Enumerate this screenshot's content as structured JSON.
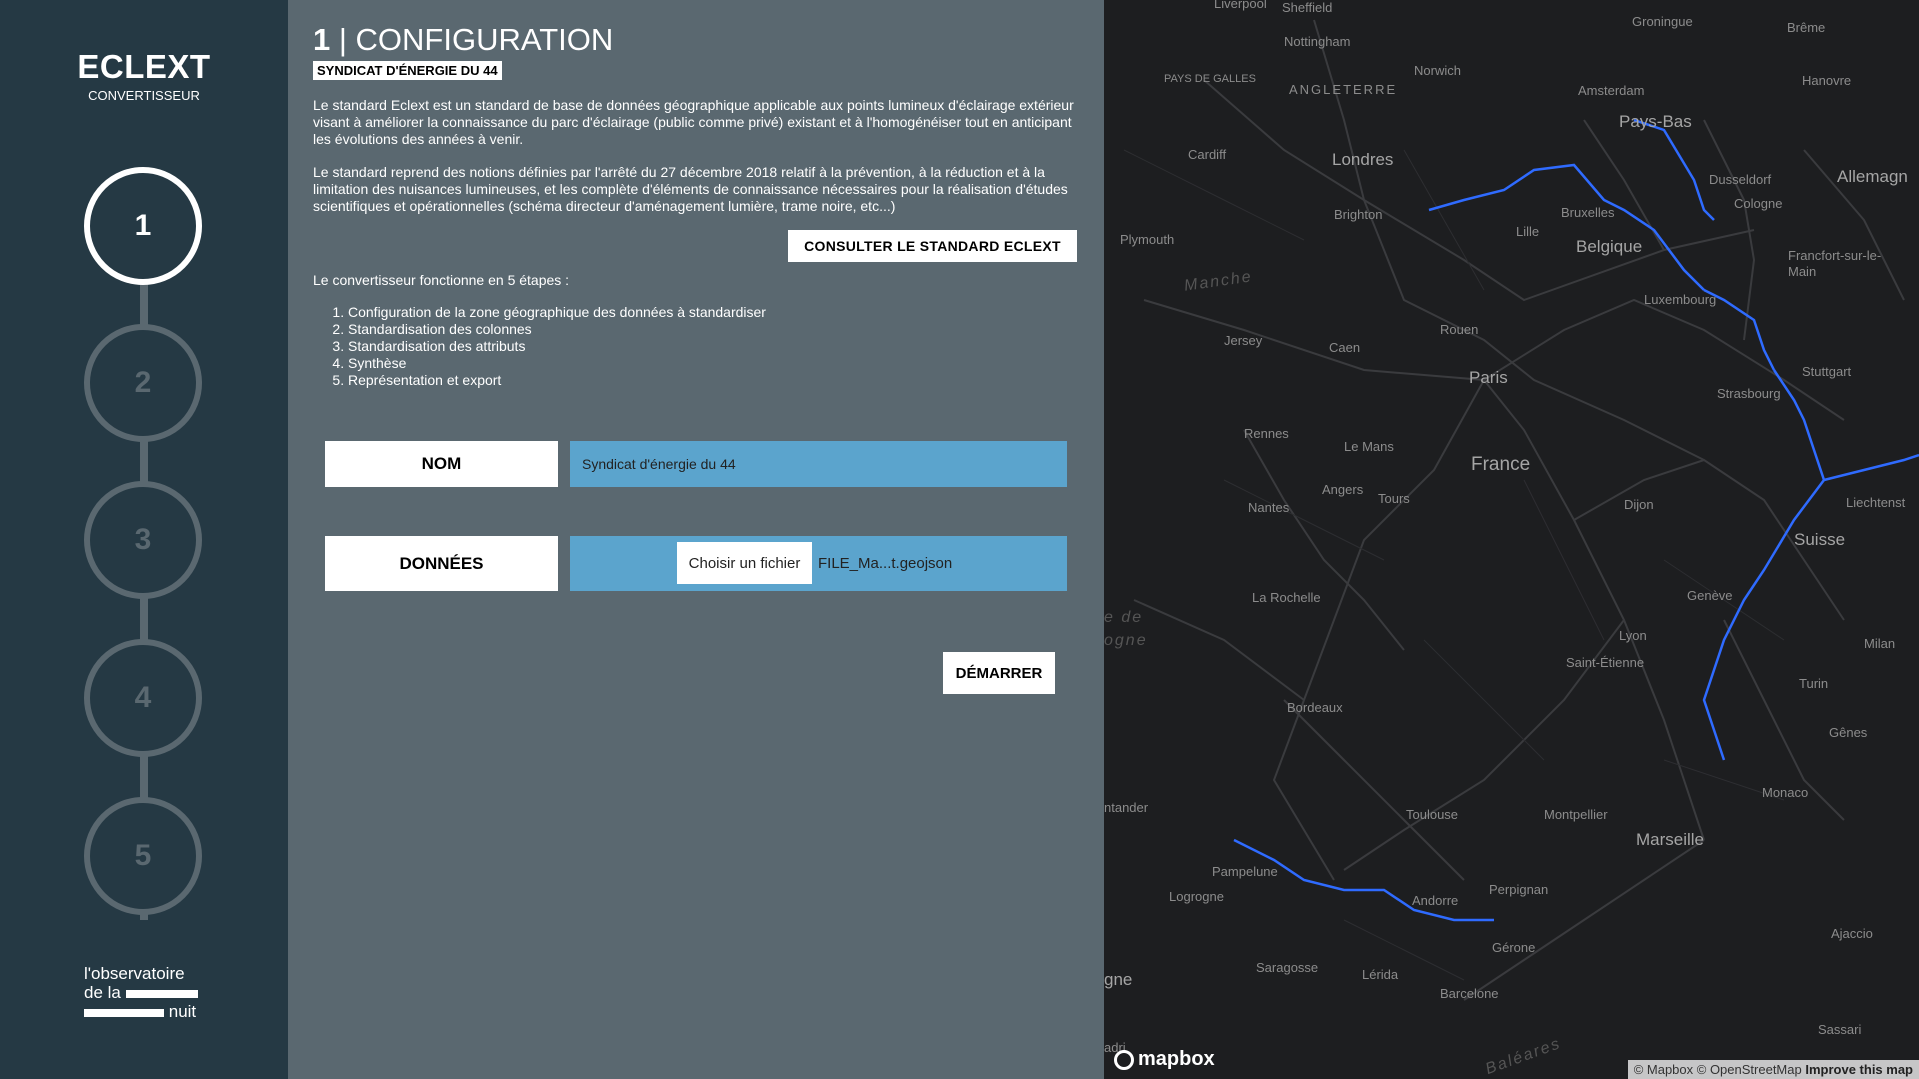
{
  "sidebar": {
    "title": "ECLEXT",
    "subtitle": "CONVERTISSEUR",
    "steps": [
      "1",
      "2",
      "3",
      "4",
      "5"
    ],
    "active_step": 1,
    "logo_lines": [
      "l'observatoire",
      "de la",
      "nuit"
    ]
  },
  "panel": {
    "title_number": "1",
    "title_text": "| CONFIGURATION",
    "tag": "SYNDICAT D'ÉNERGIE DU 44",
    "paragraph1": "Le standard Eclext est un standard de base de données géographique applicable aux points lumineux d'éclairage extérieur visant à améliorer la connaissance du parc d'éclairage (public comme privé) existant et à l'homogénéiser tout en anticipant les évolutions des années à venir.",
    "paragraph2": "Le standard reprend des notions définies par l'arrêté du 27 décembre 2018 relatif à la prévention, à la réduction et à la limitation des nuisances lumineuses, et les complète d'éléments de connaissance nécessaires pour la réalisation d'études scientifiques et opérationnelles (schéma directeur d'aménagement lumière, trame noire, etc...)",
    "consult_button": "CONSULTER LE STANDARD ECLEXT",
    "steps_intro": "Le convertisseur fonctionne en 5 étapes :",
    "steps": [
      "Configuration de la zone géographique des données à standardiser",
      "Standardisation des colonnes",
      "Standardisation des attributs",
      "Synthèse",
      "Représentation et export"
    ],
    "nom_label": "NOM",
    "nom_value": "Syndicat d'énergie du 44",
    "donnees_label": "DONNÉES",
    "file_button": "Choisir un fichier",
    "file_name": "FILE_Ma...t.geojson",
    "start_button": "DÉMARRER"
  },
  "map": {
    "labels": {
      "liverpool": "Liverpool",
      "sheffield": "Sheffield",
      "nottingham": "Nottingham",
      "norwich": "Norwich",
      "groningue": "Groningue",
      "breme": "Brême",
      "pays_de_galles": "PAYS DE GALLES",
      "angleterre": "ANGLETERRE",
      "amsterdam": "Amsterdam",
      "hanovre": "Hanovre",
      "pays_bas": "Pays-Bas",
      "cardiff": "Cardiff",
      "londres": "Londres",
      "dusseldorf": "Dusseldorf",
      "cologne": "Cologne",
      "allemagne": "Allemagn",
      "brighton": "Brighton",
      "bruxelles": "Bruxelles",
      "lille": "Lille",
      "belgique": "Belgique",
      "plymouth": "Plymouth",
      "francfort": "Francfort-sur-le-Main",
      "manche": "Manche",
      "luxembourg": "Luxembourg",
      "rouen": "Rouen",
      "jersey": "Jersey",
      "caen": "Caen",
      "stuttgart": "Stuttgart",
      "paris": "Paris",
      "strasbourg": "Strasbourg",
      "rennes": "Rennes",
      "le_mans": "Le Mans",
      "france": "France",
      "angers": "Angers",
      "tours": "Tours",
      "nantes": "Nantes",
      "dijon": "Dijon",
      "liechtenstein": "Liechtenst",
      "suisse": "Suisse",
      "la_rochelle": "La Rochelle",
      "geneve": "Genève",
      "golfe1": "e de",
      "golfe2": "ogne",
      "lyon": "Lyon",
      "milan": "Milan",
      "saint_etienne": "Saint-Étienne",
      "turin": "Turin",
      "bordeaux": "Bordeaux",
      "genes": "Gênes",
      "monaco": "Monaco",
      "santander": "ntander",
      "toulouse": "Toulouse",
      "montpellier": "Montpellier",
      "marseille": "Marseille",
      "pampelune": "Pampelune",
      "perpignan": "Perpignan",
      "logrogne": "Logrogne",
      "andorre": "Andorre",
      "ajaccio": "Ajaccio",
      "gerone": "Gérone",
      "saragosse": "Saragosse",
      "espagne": "gne",
      "lerida": "Lérida",
      "barcelone": "Barcelone",
      "sassari": "Sassari",
      "baleares": "Baléares",
      "madrid": "adri"
    },
    "mapbox_logo": "mapbox",
    "attribution": "© Mapbox © OpenStreetMap",
    "improve": "Improve this map"
  }
}
